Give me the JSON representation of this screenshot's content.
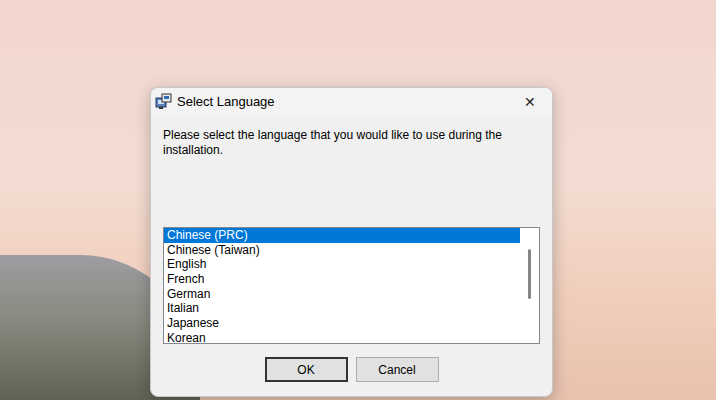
{
  "window": {
    "title": "Select Language",
    "close": "✕"
  },
  "message": "Please select the language that you would like to use during the installation.",
  "languages": [
    {
      "label": "Chinese (PRC)",
      "selected": true
    },
    {
      "label": "Chinese (Taiwan)",
      "selected": false
    },
    {
      "label": "English",
      "selected": false
    },
    {
      "label": "French",
      "selected": false
    },
    {
      "label": "German",
      "selected": false
    },
    {
      "label": "Italian",
      "selected": false
    },
    {
      "label": "Japanese",
      "selected": false
    },
    {
      "label": "Korean",
      "selected": false
    }
  ],
  "buttons": [
    {
      "label": "OK",
      "default": true
    },
    {
      "label": "Cancel",
      "default": false
    }
  ]
}
